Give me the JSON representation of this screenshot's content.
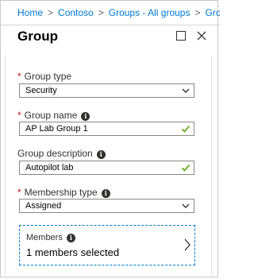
{
  "breadcrumb": {
    "items": [
      "Home",
      "Contoso",
      "Groups - All groups",
      "Grou"
    ],
    "separator": ">"
  },
  "header": {
    "title": "Group",
    "icons": [
      "maximize-icon",
      "close-icon"
    ]
  },
  "form": {
    "group_type": {
      "label": "Group type",
      "required": true,
      "value": "Security"
    },
    "group_name": {
      "label": "Group name",
      "required": true,
      "value": "AP Lab Group 1"
    },
    "group_description": {
      "label": "Group description",
      "required": false,
      "value": "Autopilot lab"
    },
    "membership_type": {
      "label": "Membership type",
      "required": true,
      "value": "Assigned"
    },
    "members": {
      "label": "Members",
      "value": "1 members selected"
    },
    "required_marker": "*",
    "info_glyph": "i"
  },
  "colors": {
    "link": "#0078d4",
    "required": "#c50f1f",
    "valid_check": "#57a300",
    "border": "#8a8886"
  }
}
